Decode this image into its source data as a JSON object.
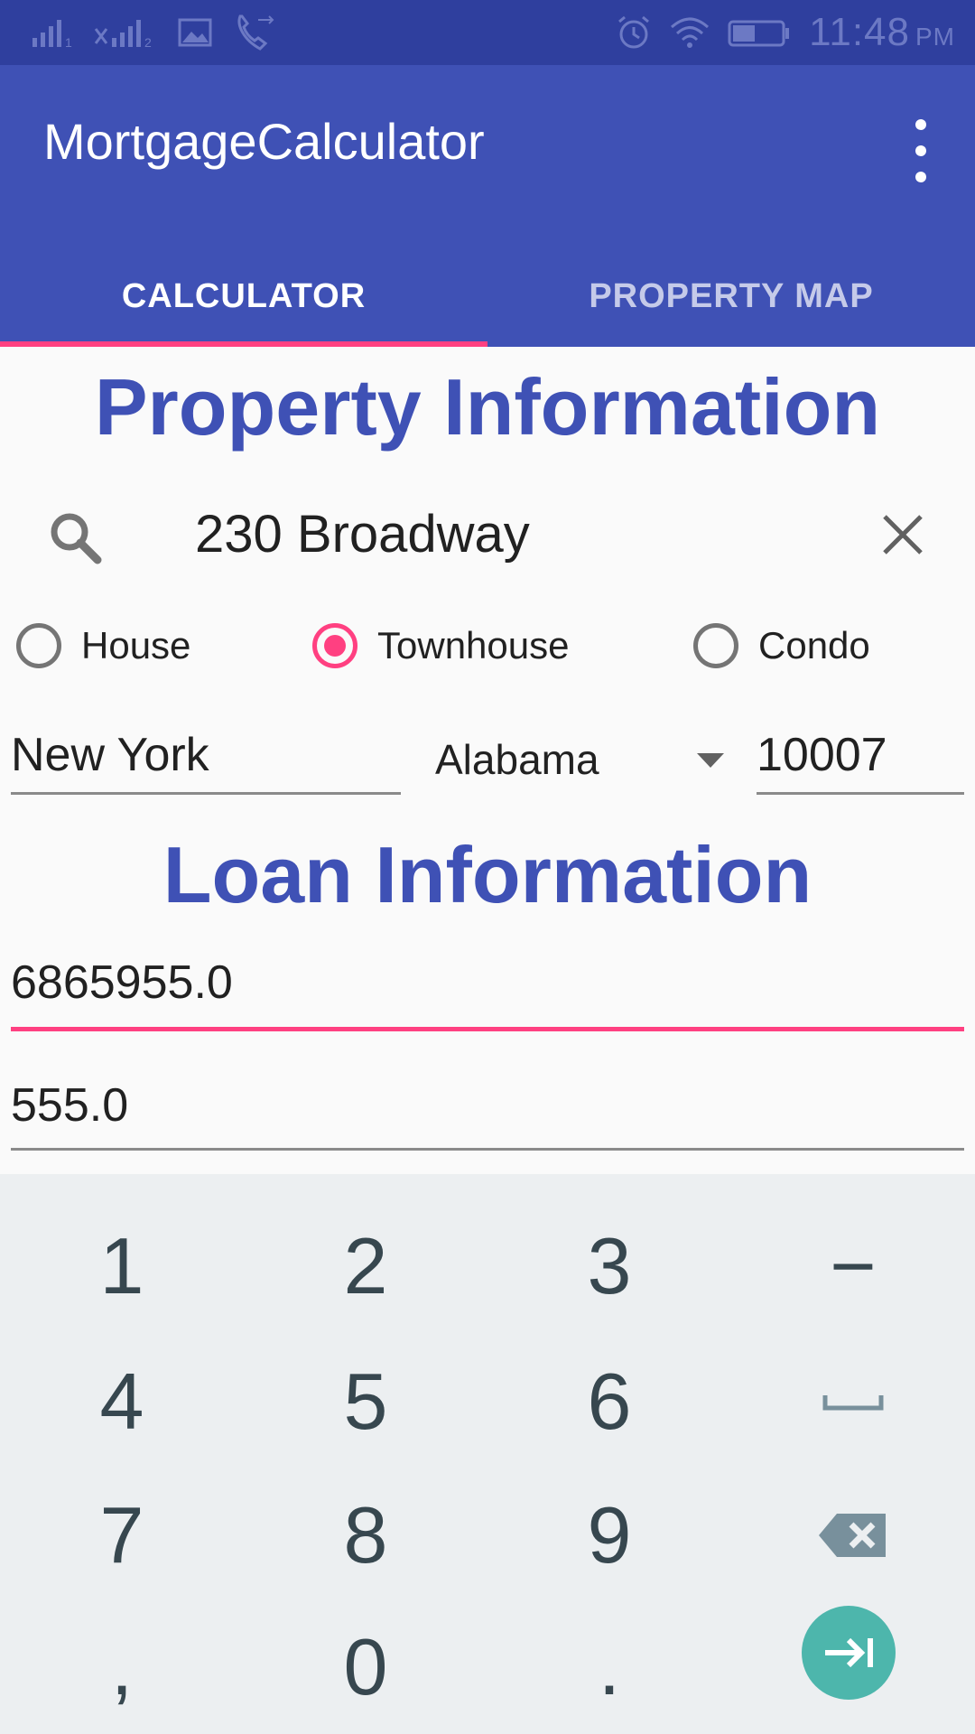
{
  "status_bar": {
    "sim1_label": "1",
    "sim2_label": "2",
    "time": "11:48",
    "ampm": "PM"
  },
  "app_bar": {
    "title": "MortgageCalculator",
    "tabs": [
      {
        "label": "CALCULATOR",
        "active": true
      },
      {
        "label": "PROPERTY MAP",
        "active": false
      }
    ]
  },
  "property": {
    "heading": "Property Information",
    "search_value": "230 Broadway",
    "property_types": [
      {
        "label": "House",
        "checked": false
      },
      {
        "label": "Townhouse",
        "checked": true
      },
      {
        "label": "Condo",
        "checked": false
      }
    ],
    "city": "New York",
    "state": "Alabama",
    "zip": "10007"
  },
  "loan": {
    "heading": "Loan Information",
    "amount": "6865955.0",
    "second_value": "555.0"
  },
  "keyboard": {
    "keys": [
      "1",
      "2",
      "3",
      "−",
      "4",
      "5",
      "6",
      "␣",
      "7",
      "8",
      "9",
      "⌫",
      ",",
      "0",
      "."
    ],
    "icons": [
      "space-icon",
      "backspace-icon",
      "enter-icon"
    ]
  },
  "colors": {
    "primary": "#3f51b5",
    "primary_dark": "#2f3f9e",
    "accent": "#ff4081",
    "enter_key": "#4db6ac"
  }
}
